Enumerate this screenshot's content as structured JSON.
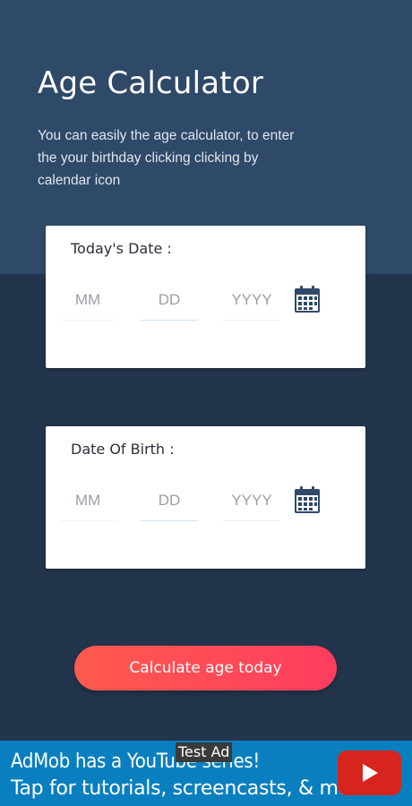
{
  "header": {
    "title": "Age Calculator",
    "description": "You can easily the age calculator, to enter the your birthday clicking clicking by calendar icon"
  },
  "today_card": {
    "label": "Today's Date :",
    "month_placeholder": "MM",
    "day_placeholder": "DD",
    "year_placeholder": "YYYY",
    "icon": "calendar-icon"
  },
  "birth_card": {
    "label": "Date Of Birth :",
    "month_placeholder": "MM",
    "day_placeholder": "DD",
    "year_placeholder": "YYYY",
    "icon": "calendar-icon"
  },
  "calculate_button": {
    "label": "Calculate age today"
  },
  "ad": {
    "tag": "Test Ad",
    "line1": "AdMob has a YouTube series!",
    "line2": "Tap for tutorials, screencasts, & more.",
    "icon": "youtube-play-icon"
  },
  "colors": {
    "header_bg": "#2f4968",
    "body_bg": "#23354d",
    "button_gradient_start": "#ff5a4e",
    "button_gradient_end": "#ff3d5f",
    "icon_color": "#2f4968",
    "ad_bg": "#0a7fc0"
  }
}
